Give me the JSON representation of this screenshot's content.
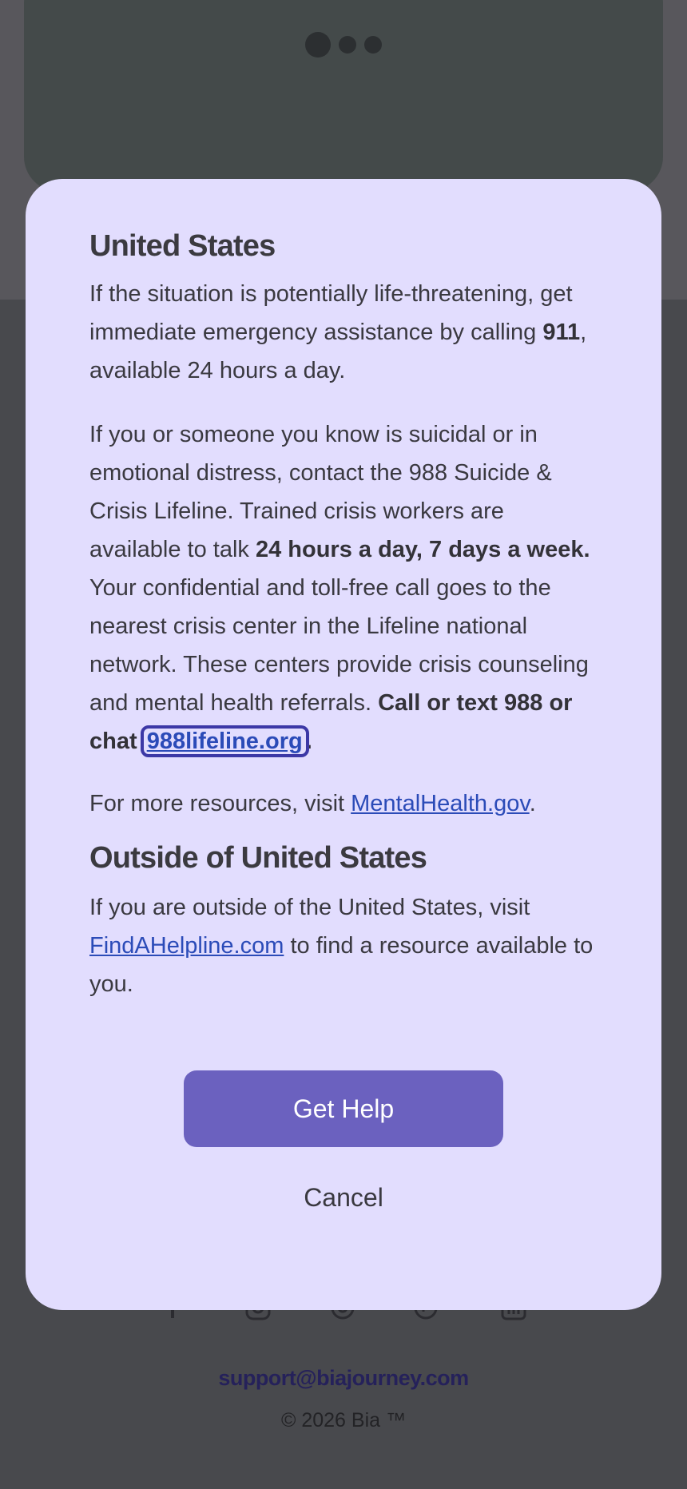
{
  "modal": {
    "us_heading": "United States",
    "us_p1_a": "If the situation is potentially life-threatening, get immediate emergency assistance by calling ",
    "us_p1_b": "911",
    "us_p1_c": ", available 24 hours a day.",
    "us_p2_a": "If you or someone you know is suicidal or in emotional distress, contact the 988 Suicide & Crisis Lifeline. Trained crisis workers are available to talk ",
    "us_p2_b": "24 hours a day, 7 days a week.",
    "us_p2_c": " Your confidential and toll-free call goes to the nearest crisis center in the Lifeline national network. These centers provide crisis counseling and mental health referrals. ",
    "us_p2_d": "Call or text 988 or chat ",
    "us_p2_link": "988lifeline.org",
    "us_p2_end": ".",
    "us_p3_a": "For more resources, visit ",
    "us_p3_link": "MentalHealth.gov",
    "us_p3_end": ".",
    "intl_heading": "Outside of United States",
    "intl_p_a": "If you are outside of the United States, visit ",
    "intl_p_link": "FindAHelpline.com",
    "intl_p_b": " to find a resource available to you.",
    "get_help_label": "Get Help",
    "cancel_label": "Cancel"
  },
  "footer": {
    "email": "support@biajourney.com",
    "copyright": "© 2026 Bia ™",
    "social_icons": [
      "facebook-icon",
      "instagram-icon",
      "threads-icon",
      "tiktok-icon",
      "linkedin-icon"
    ]
  },
  "colors": {
    "modal_bg": "#e2ddfe",
    "primary_button": "#6b61bf",
    "link": "#2b4bb8",
    "focus_ring": "#3c38a6"
  }
}
